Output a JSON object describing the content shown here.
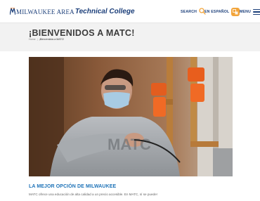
{
  "header": {
    "logo_text_1": "MILWAUKEE AREA",
    "logo_text_2": "Technical College",
    "search_label": "SEARCH",
    "spanish_label": "EN ESPAÑOL",
    "menu_label": "MENU"
  },
  "hero": {
    "title": "¡BIENVENIDOS A MATC!",
    "breadcrumb": [
      "Home",
      "¡Bienvenidos a MATC!"
    ]
  },
  "section": {
    "heading": "LA MEJOR OPCIÓN DE MILWAUKEE",
    "text": "MATC ofrece una educación de alta calidad a un precio accesible. En MATC, sí se puede!"
  },
  "colors": {
    "brand_blue": "#1c3f7a",
    "heading_blue": "#1e73b8",
    "accent_orange": "#e8843a",
    "band_gray": "#f2f2f2"
  },
  "icons": {
    "search": "search-icon",
    "spanish": "translate-badge-icon",
    "menu": "hamburger-menu-icon"
  }
}
